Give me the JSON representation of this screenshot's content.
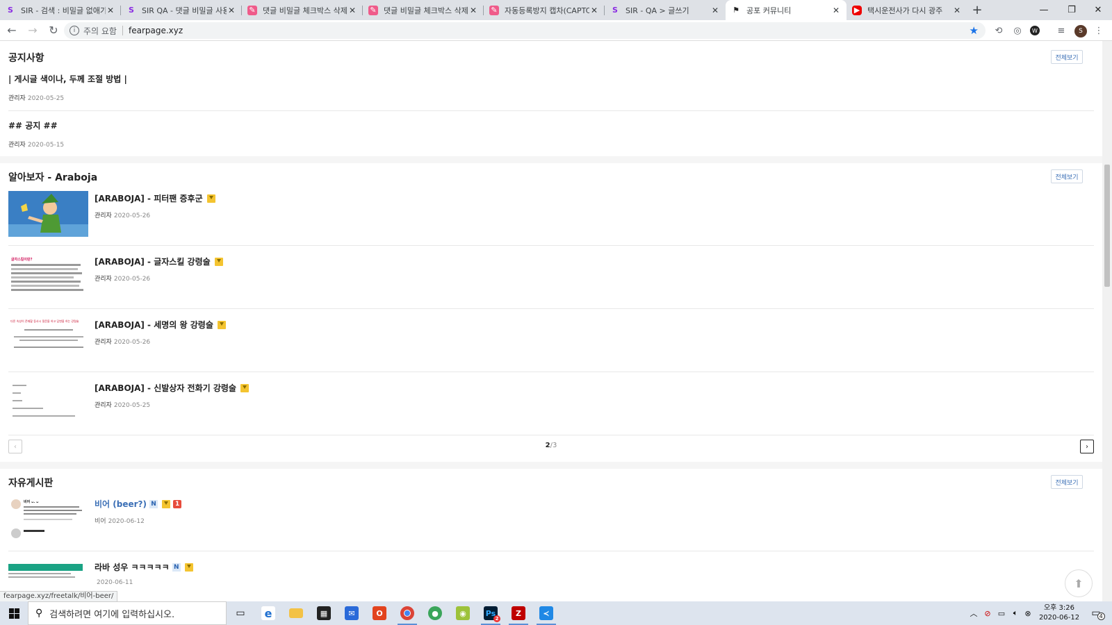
{
  "browser": {
    "tabs": [
      {
        "label": "SIR - 검색 : 비밀글 없애기",
        "favicon": "sir-s-icon",
        "active": false
      },
      {
        "label": "SIR QA - 댓글 비밀글 사용",
        "favicon": "sir-s-icon",
        "active": false
      },
      {
        "label": "댓글 비밀글 체크박스 삭제",
        "favicon": "pen-icon",
        "active": false
      },
      {
        "label": "댓글 비밀글 체크박스 삭제",
        "favicon": "pen-icon",
        "active": false
      },
      {
        "label": "자동등록방지 캡차(CAPTCHA",
        "favicon": "pen-icon",
        "active": false
      },
      {
        "label": "SIR - QA > 글쓰기",
        "favicon": "sir-s-icon",
        "active": false
      },
      {
        "label": "공포 커뮤니티",
        "favicon": "flag-icon",
        "active": true
      },
      {
        "label": "택시운전사가 다시 광주",
        "favicon": "youtube-icon",
        "active": false
      }
    ],
    "new_tab_label": "+",
    "security_label": "주의 요함",
    "url": "fearpage.xyz",
    "status_url": "fearpage.xyz/freetalk/비어-beer/",
    "profile_initial": "S"
  },
  "notice": {
    "title": "공지사항",
    "more_label": "전체보기",
    "items": [
      {
        "title": "| 게시글 색이나, 두께 조절 방법 |",
        "author": "관리자",
        "date": "2020-05-25"
      },
      {
        "title": "## 공지 ##",
        "author": "관리자",
        "date": "2020-05-15"
      }
    ]
  },
  "araboja": {
    "title": "알아보자 - Araboja",
    "more_label": "전체보기",
    "items": [
      {
        "title": "[ARABOJA] - 피터팬 증후군",
        "author": "관리자",
        "date": "2020-05-26"
      },
      {
        "title": "[ARABOJA] - 글자스킬 강령술",
        "author": "관리자",
        "date": "2020-05-26"
      },
      {
        "title": "[ARABOJA] - 세명의 왕 강령술",
        "author": "관리자",
        "date": "2020-05-26"
      },
      {
        "title": "[ARABOJA] - 신발상자 전화기 강령술",
        "author": "관리자",
        "date": "2020-05-25"
      }
    ],
    "pager": {
      "current": "2",
      "total": "/3",
      "prev": "‹",
      "next": "›"
    }
  },
  "freeboard": {
    "title": "자유게시판",
    "more_label": "전체보기",
    "items": [
      {
        "title": "비어 (beer?)",
        "badge_new": "N",
        "comment_count": "1",
        "author": "비어",
        "date": "2020-06-12"
      },
      {
        "title": "라바 성우 ㅋㅋㅋㅋㅋ",
        "badge_new": "N",
        "author": "",
        "date": "2020-06-11"
      }
    ]
  },
  "thumb_text": {
    "a2_head": "글자스킬이란?",
    "a3_head": "다른 속성이 존재할 동사시 질문을 하고 답변을 하는 강령술",
    "f1_head": "비어 ᴗ. ᴗ"
  },
  "taskbar": {
    "search_placeholder": "검색하려면 여기에 입력하십시오.",
    "time": "오후 3:26",
    "date": "2020-06-12",
    "notification_count": "4",
    "mail_badge": "2"
  },
  "colors": {
    "accent": "#3b6fb6",
    "download_badge": "#f4c430",
    "comment_badge": "#e74c3c"
  }
}
